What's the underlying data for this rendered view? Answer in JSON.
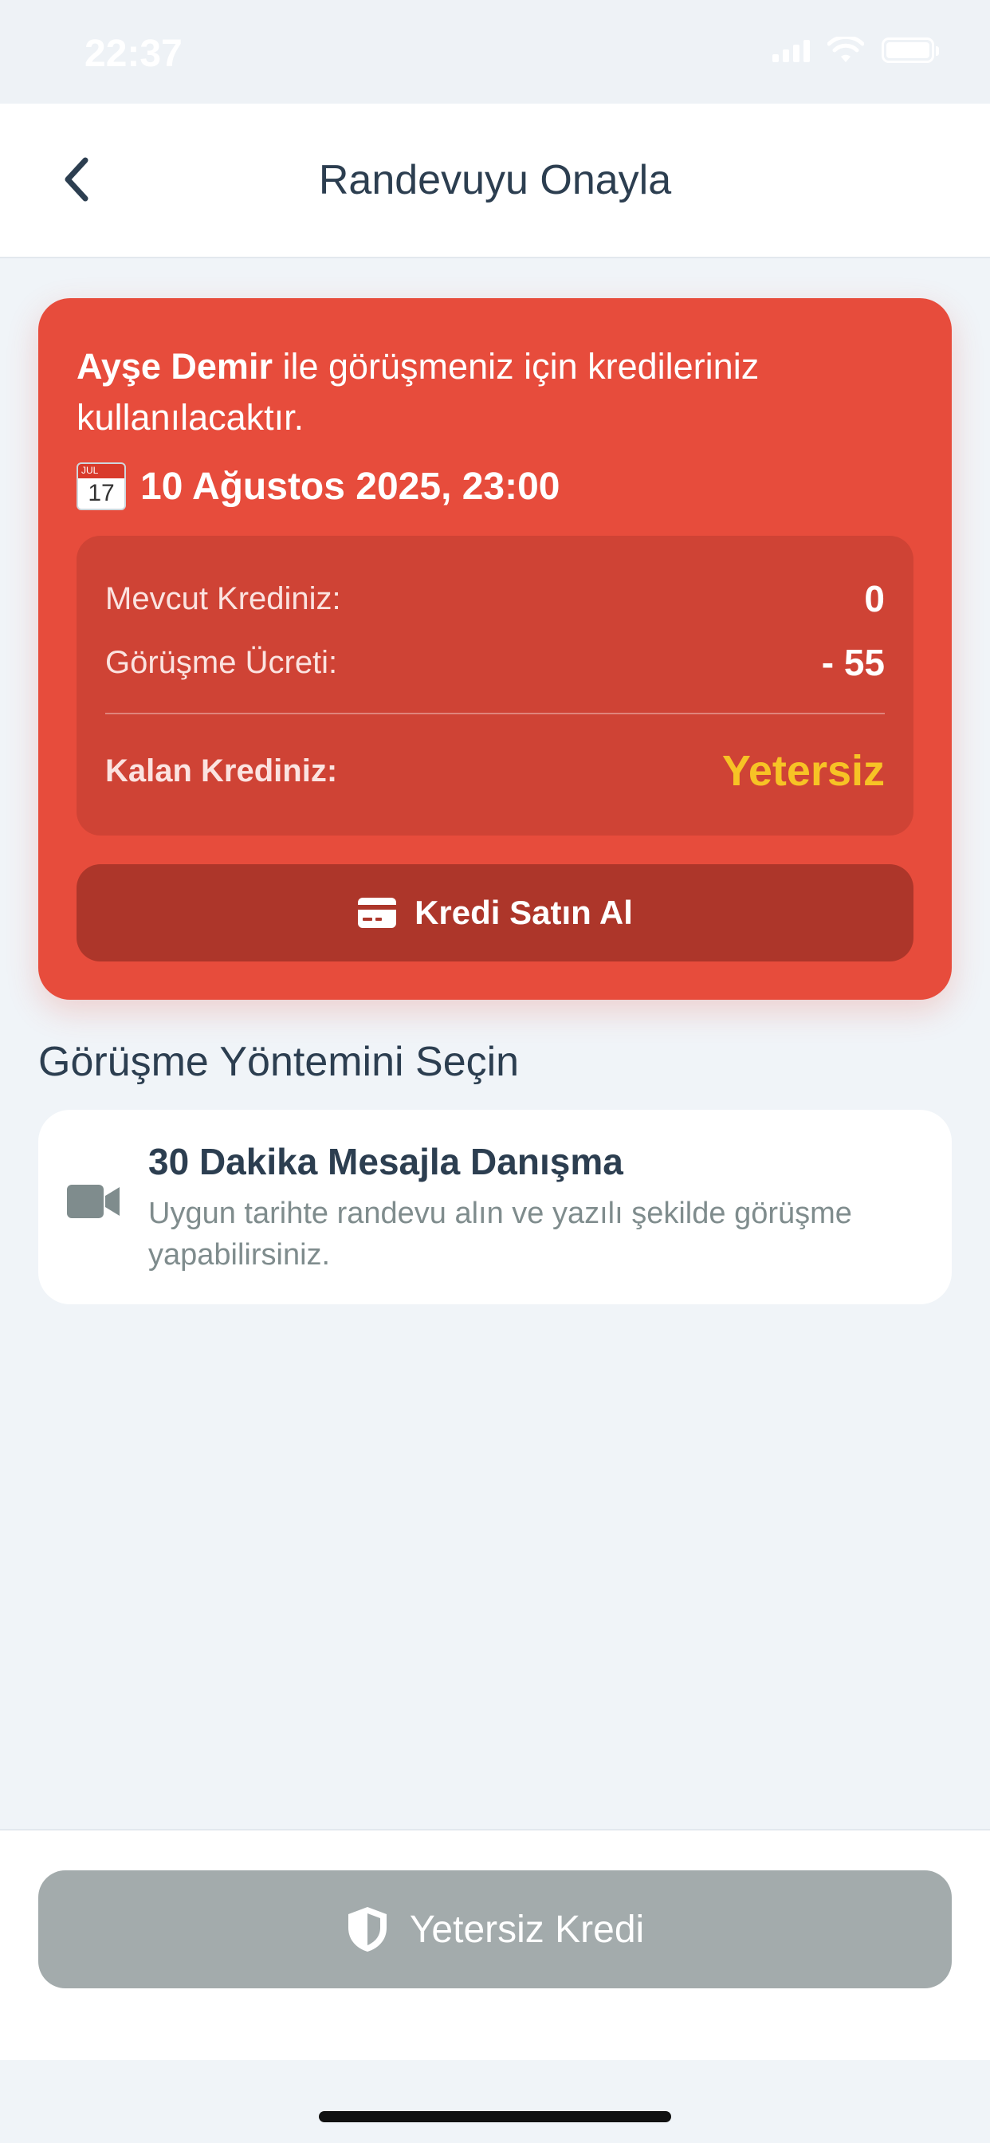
{
  "status_bar": {
    "time": "22:37"
  },
  "header": {
    "title": "Randevuyu Onayla"
  },
  "appointment": {
    "doctor_name": "Ayşe Demir",
    "info_suffix": " ile görüşmeniz için kredileriniz kullanılacaktır.",
    "calendar_month": "JUL",
    "calendar_day": "17",
    "date_time": "10 Ağustos 2025, 23:00"
  },
  "credits": {
    "current_label": "Mevcut Krediniz:",
    "current_value": "0",
    "fee_label": "Görüşme Ücreti:",
    "fee_value": "- 55",
    "remaining_label": "Kalan Krediniz:",
    "remaining_value": "Yetersiz",
    "buy_button_label": "Kredi Satın Al"
  },
  "method_section": {
    "title": "Görüşme Yöntemini Seçin",
    "option": {
      "icon": "video-camera-icon",
      "title": "30 Dakika Mesajla Danışma",
      "description": "Uygun tarihte randevu alın ve yazılı şekilde görüşme yapabilirsiniz."
    }
  },
  "footer": {
    "button_label": "Yetersiz Kredi",
    "button_icon": "shield-icon"
  },
  "colors": {
    "card_red": "#e74c3c",
    "summary_red": "#cf4335",
    "button_dark_red": "#ad362a",
    "warning_yellow": "#f7c325",
    "disabled_gray": "#a3abac",
    "text_dark": "#2c3e50"
  }
}
